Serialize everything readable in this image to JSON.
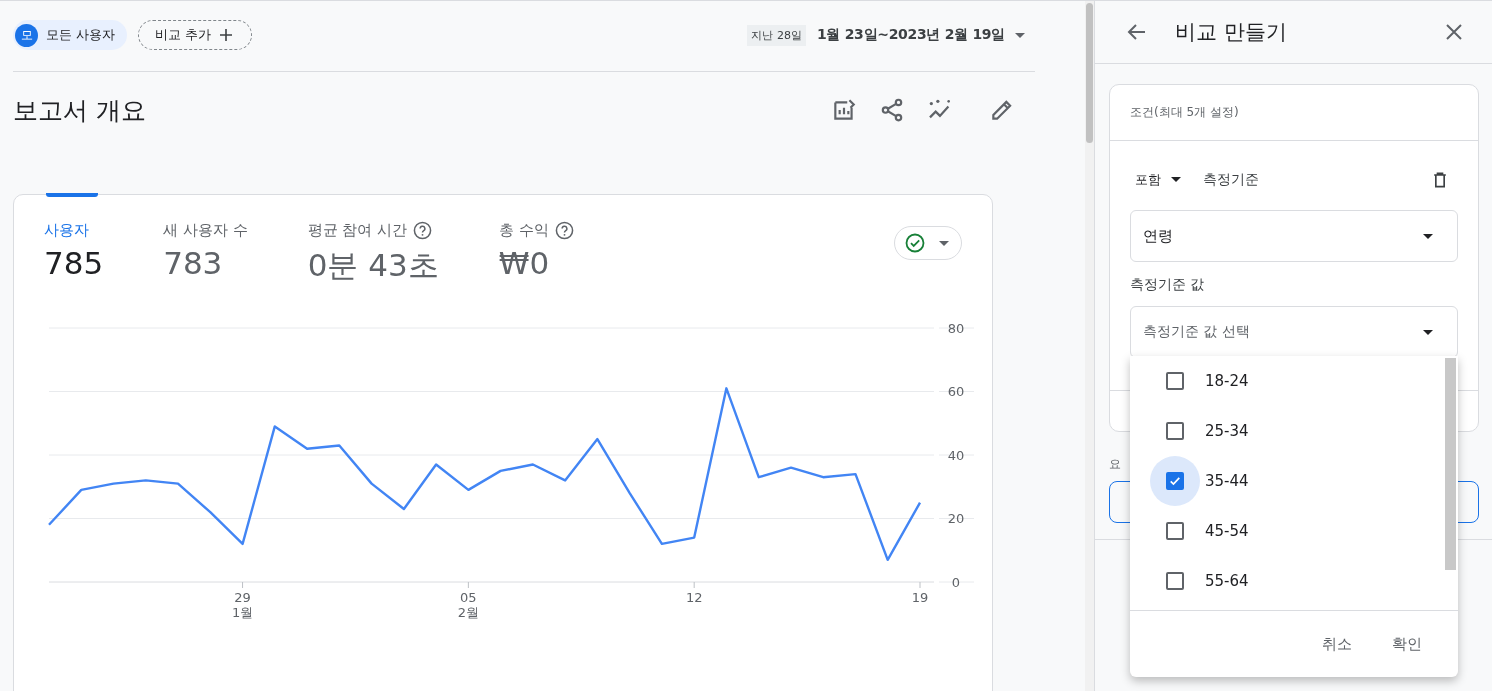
{
  "filters": {
    "segment": {
      "avatar": "모",
      "label": "모든 사용자"
    },
    "add_comparison": "비교 추가"
  },
  "date_range": {
    "preset": "지난 28일",
    "range": "1월 23일~2023년 2월 19일"
  },
  "title": "보고서 개요",
  "metrics": [
    {
      "label": "사용자",
      "value": "785",
      "help": false,
      "selected": true
    },
    {
      "label": "새 사용자 수",
      "value": "783",
      "help": false,
      "selected": false
    },
    {
      "label": "평균 참여 시간",
      "value": "0분 43초",
      "help": true,
      "selected": false
    },
    {
      "label": "총 수익",
      "value": "₩0",
      "help": true,
      "selected": false
    }
  ],
  "chart_data": {
    "type": "line",
    "categories": [
      null,
      null,
      null,
      null,
      null,
      null,
      "29",
      null,
      null,
      null,
      null,
      null,
      null,
      "05",
      null,
      null,
      null,
      null,
      null,
      null,
      "12",
      null,
      null,
      null,
      null,
      null,
      null,
      "19"
    ],
    "series": [
      {
        "color": "#4285f4",
        "values": [
          18,
          29,
          31,
          32,
          31,
          22,
          12,
          49,
          42,
          43,
          31,
          23,
          37,
          29,
          35,
          37,
          32,
          45,
          28,
          12,
          14,
          61,
          33,
          36,
          33,
          34,
          7,
          25
        ]
      }
    ],
    "ylim": [
      0,
      80
    ],
    "yticks": [
      0,
      20,
      40,
      60,
      80
    ],
    "grid": true,
    "annotations": [
      "1월",
      "2월"
    ]
  },
  "panel": {
    "title": "비교 만들기",
    "conditions": {
      "heading": "조건(최대 5개 설정)",
      "include": "포함",
      "dimension_label": "측정기준",
      "dimension": "연령",
      "value_label": "측정기준 값",
      "value_placeholder": "측정기준 값 선택"
    },
    "summary_label": "요",
    "options": [
      {
        "label": "18-24",
        "checked": false,
        "focused": false
      },
      {
        "label": "25-34",
        "checked": false,
        "focused": false
      },
      {
        "label": "35-44",
        "checked": true,
        "focused": true
      },
      {
        "label": "45-54",
        "checked": false,
        "focused": false
      },
      {
        "label": "55-64",
        "checked": false,
        "focused": false
      }
    ],
    "buttons": [
      "취소",
      "확인"
    ]
  }
}
